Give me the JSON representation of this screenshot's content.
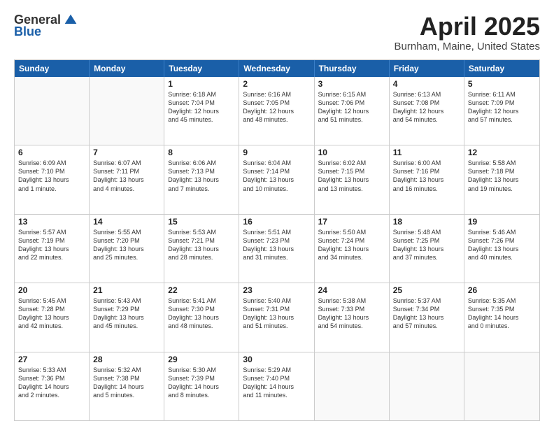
{
  "header": {
    "logo_general": "General",
    "logo_blue": "Blue",
    "title": "April 2025",
    "location": "Burnham, Maine, United States"
  },
  "days_of_week": [
    "Sunday",
    "Monday",
    "Tuesday",
    "Wednesday",
    "Thursday",
    "Friday",
    "Saturday"
  ],
  "weeks": [
    [
      {
        "day": "",
        "text": ""
      },
      {
        "day": "",
        "text": ""
      },
      {
        "day": "1",
        "text": "Sunrise: 6:18 AM\nSunset: 7:04 PM\nDaylight: 12 hours\nand 45 minutes."
      },
      {
        "day": "2",
        "text": "Sunrise: 6:16 AM\nSunset: 7:05 PM\nDaylight: 12 hours\nand 48 minutes."
      },
      {
        "day": "3",
        "text": "Sunrise: 6:15 AM\nSunset: 7:06 PM\nDaylight: 12 hours\nand 51 minutes."
      },
      {
        "day": "4",
        "text": "Sunrise: 6:13 AM\nSunset: 7:08 PM\nDaylight: 12 hours\nand 54 minutes."
      },
      {
        "day": "5",
        "text": "Sunrise: 6:11 AM\nSunset: 7:09 PM\nDaylight: 12 hours\nand 57 minutes."
      }
    ],
    [
      {
        "day": "6",
        "text": "Sunrise: 6:09 AM\nSunset: 7:10 PM\nDaylight: 13 hours\nand 1 minute."
      },
      {
        "day": "7",
        "text": "Sunrise: 6:07 AM\nSunset: 7:11 PM\nDaylight: 13 hours\nand 4 minutes."
      },
      {
        "day": "8",
        "text": "Sunrise: 6:06 AM\nSunset: 7:13 PM\nDaylight: 13 hours\nand 7 minutes."
      },
      {
        "day": "9",
        "text": "Sunrise: 6:04 AM\nSunset: 7:14 PM\nDaylight: 13 hours\nand 10 minutes."
      },
      {
        "day": "10",
        "text": "Sunrise: 6:02 AM\nSunset: 7:15 PM\nDaylight: 13 hours\nand 13 minutes."
      },
      {
        "day": "11",
        "text": "Sunrise: 6:00 AM\nSunset: 7:16 PM\nDaylight: 13 hours\nand 16 minutes."
      },
      {
        "day": "12",
        "text": "Sunrise: 5:58 AM\nSunset: 7:18 PM\nDaylight: 13 hours\nand 19 minutes."
      }
    ],
    [
      {
        "day": "13",
        "text": "Sunrise: 5:57 AM\nSunset: 7:19 PM\nDaylight: 13 hours\nand 22 minutes."
      },
      {
        "day": "14",
        "text": "Sunrise: 5:55 AM\nSunset: 7:20 PM\nDaylight: 13 hours\nand 25 minutes."
      },
      {
        "day": "15",
        "text": "Sunrise: 5:53 AM\nSunset: 7:21 PM\nDaylight: 13 hours\nand 28 minutes."
      },
      {
        "day": "16",
        "text": "Sunrise: 5:51 AM\nSunset: 7:23 PM\nDaylight: 13 hours\nand 31 minutes."
      },
      {
        "day": "17",
        "text": "Sunrise: 5:50 AM\nSunset: 7:24 PM\nDaylight: 13 hours\nand 34 minutes."
      },
      {
        "day": "18",
        "text": "Sunrise: 5:48 AM\nSunset: 7:25 PM\nDaylight: 13 hours\nand 37 minutes."
      },
      {
        "day": "19",
        "text": "Sunrise: 5:46 AM\nSunset: 7:26 PM\nDaylight: 13 hours\nand 40 minutes."
      }
    ],
    [
      {
        "day": "20",
        "text": "Sunrise: 5:45 AM\nSunset: 7:28 PM\nDaylight: 13 hours\nand 42 minutes."
      },
      {
        "day": "21",
        "text": "Sunrise: 5:43 AM\nSunset: 7:29 PM\nDaylight: 13 hours\nand 45 minutes."
      },
      {
        "day": "22",
        "text": "Sunrise: 5:41 AM\nSunset: 7:30 PM\nDaylight: 13 hours\nand 48 minutes."
      },
      {
        "day": "23",
        "text": "Sunrise: 5:40 AM\nSunset: 7:31 PM\nDaylight: 13 hours\nand 51 minutes."
      },
      {
        "day": "24",
        "text": "Sunrise: 5:38 AM\nSunset: 7:33 PM\nDaylight: 13 hours\nand 54 minutes."
      },
      {
        "day": "25",
        "text": "Sunrise: 5:37 AM\nSunset: 7:34 PM\nDaylight: 13 hours\nand 57 minutes."
      },
      {
        "day": "26",
        "text": "Sunrise: 5:35 AM\nSunset: 7:35 PM\nDaylight: 14 hours\nand 0 minutes."
      }
    ],
    [
      {
        "day": "27",
        "text": "Sunrise: 5:33 AM\nSunset: 7:36 PM\nDaylight: 14 hours\nand 2 minutes."
      },
      {
        "day": "28",
        "text": "Sunrise: 5:32 AM\nSunset: 7:38 PM\nDaylight: 14 hours\nand 5 minutes."
      },
      {
        "day": "29",
        "text": "Sunrise: 5:30 AM\nSunset: 7:39 PM\nDaylight: 14 hours\nand 8 minutes."
      },
      {
        "day": "30",
        "text": "Sunrise: 5:29 AM\nSunset: 7:40 PM\nDaylight: 14 hours\nand 11 minutes."
      },
      {
        "day": "",
        "text": ""
      },
      {
        "day": "",
        "text": ""
      },
      {
        "day": "",
        "text": ""
      }
    ]
  ]
}
